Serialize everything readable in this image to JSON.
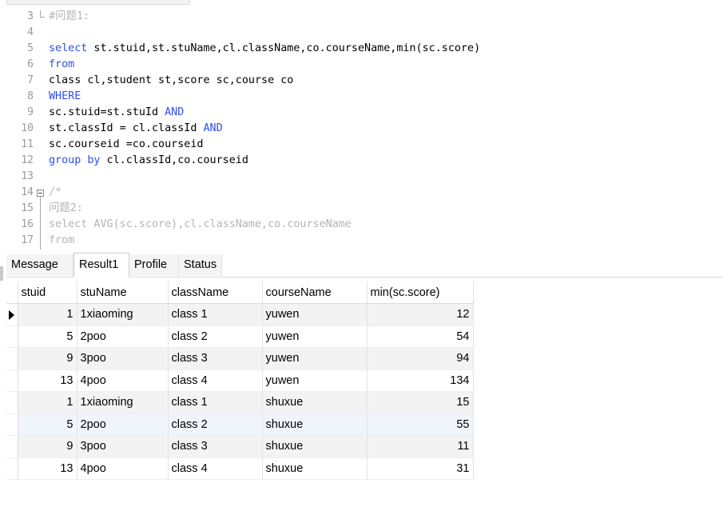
{
  "editor": {
    "lines": [
      {
        "num": "3",
        "parts": [
          {
            "t": "#问题1:",
            "c": "cm"
          }
        ]
      },
      {
        "num": "4",
        "parts": []
      },
      {
        "num": "5",
        "parts": [
          {
            "t": "select",
            "c": "kw"
          },
          {
            "t": " st.stuid,st.stuName,cl.className,co.courseName,min(sc.score)",
            "c": ""
          }
        ]
      },
      {
        "num": "6",
        "parts": [
          {
            "t": "from",
            "c": "kw"
          }
        ]
      },
      {
        "num": "7",
        "parts": [
          {
            "t": "class cl,student st,score sc,course co",
            "c": ""
          }
        ]
      },
      {
        "num": "8",
        "parts": [
          {
            "t": "WHERE",
            "c": "kw"
          }
        ]
      },
      {
        "num": "9",
        "parts": [
          {
            "t": "sc.stuid=st.stuId ",
            "c": ""
          },
          {
            "t": "AND",
            "c": "kw"
          }
        ]
      },
      {
        "num": "10",
        "parts": [
          {
            "t": "st.classId = cl.classId ",
            "c": ""
          },
          {
            "t": "AND",
            "c": "kw"
          }
        ]
      },
      {
        "num": "11",
        "parts": [
          {
            "t": "sc.courseid =co.courseid",
            "c": ""
          }
        ]
      },
      {
        "num": "12",
        "parts": [
          {
            "t": "group by",
            "c": "kw"
          },
          {
            "t": " cl.classId,co.courseid",
            "c": ""
          }
        ]
      },
      {
        "num": "13",
        "parts": []
      },
      {
        "num": "14",
        "parts": [
          {
            "t": "/*",
            "c": "cm"
          }
        ]
      },
      {
        "num": "15",
        "parts": [
          {
            "t": "问题2:",
            "c": "cm"
          }
        ]
      },
      {
        "num": "16",
        "parts": [
          {
            "t": "select AVG(sc.score),cl.className,co.courseName",
            "c": "cm"
          }
        ]
      },
      {
        "num": "17",
        "parts": [
          {
            "t": "from",
            "c": "cm"
          }
        ]
      }
    ]
  },
  "tabs": [
    "Message",
    "Result1",
    "Profile",
    "Status"
  ],
  "active_tab": "Result1",
  "grid": {
    "columns": [
      "stuid",
      "stuName",
      "className",
      "courseName",
      "min(sc.score)"
    ],
    "rows": [
      [
        "1",
        "1xiaoming",
        "class 1",
        "yuwen",
        "12"
      ],
      [
        "5",
        "2poo",
        "class 2",
        "yuwen",
        "54"
      ],
      [
        "9",
        "3poo",
        "class 3",
        "yuwen",
        "94"
      ],
      [
        "13",
        "4poo",
        "class 4",
        "yuwen",
        "134"
      ],
      [
        "1",
        "1xiaoming",
        "class 1",
        "shuxue",
        "15"
      ],
      [
        "5",
        "2poo",
        "class 2",
        "shuxue",
        "55"
      ],
      [
        "9",
        "3poo",
        "class 3",
        "shuxue",
        "11"
      ],
      [
        "13",
        "4poo",
        "class 4",
        "shuxue",
        "31"
      ]
    ],
    "current_row": 0,
    "highlighted_row": 5
  }
}
